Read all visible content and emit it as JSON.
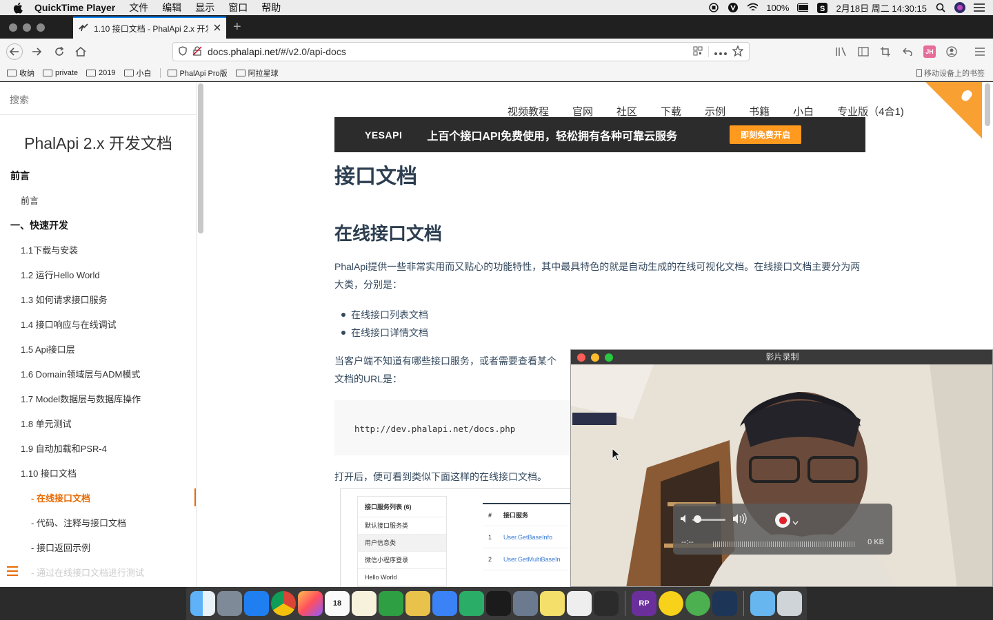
{
  "menubar": {
    "app_name": "QuickTime Player",
    "menus": [
      "文件",
      "编辑",
      "显示",
      "窗口",
      "帮助"
    ],
    "battery": "100%",
    "datetime": "2月18日 周二  14:30:15"
  },
  "browser": {
    "tab_title": "1.10 接口文档 - PhalApi 2.x 开发",
    "url_prefix": "docs.",
    "url_domain": "phalapi.net",
    "url_rest": "/#/v2.0/api-docs",
    "bookmarks": [
      "收纳",
      "private",
      "2019",
      "小白",
      "PhalApi Pro版",
      "阿拉星球"
    ],
    "mobile_bookmarks": "移动设备上的书签"
  },
  "sidebar": {
    "search_placeholder": "搜索",
    "title": "PhalApi 2.x 开发文档",
    "items": [
      {
        "label": "前言",
        "level": "h"
      },
      {
        "label": "前言",
        "level": "l1"
      },
      {
        "label": "一、快速开发",
        "level": "h"
      },
      {
        "label": "1.1下载与安装",
        "level": "l1"
      },
      {
        "label": "1.2 运行Hello World",
        "level": "l1"
      },
      {
        "label": "1.3 如何请求接口服务",
        "level": "l1"
      },
      {
        "label": "1.4 接口响应与在线调试",
        "level": "l1"
      },
      {
        "label": "1.5 Api接口层",
        "level": "l1"
      },
      {
        "label": "1.6 Domain领域层与ADM模式",
        "level": "l1"
      },
      {
        "label": "1.7 Model数据层与数据库操作",
        "level": "l1"
      },
      {
        "label": "1.8 单元测试",
        "level": "l1"
      },
      {
        "label": "1.9 自动加载和PSR-4",
        "level": "l1"
      },
      {
        "label": "1.10 接口文档",
        "level": "l1"
      },
      {
        "label": "- 在线接口文档",
        "level": "l2",
        "active": true
      },
      {
        "label": "- 代码、注释与接口文档",
        "level": "l2"
      },
      {
        "label": "- 接口返回示例",
        "level": "l2"
      },
      {
        "label": "- 通过在线接口文档进行测试",
        "level": "l2",
        "faded": true
      }
    ]
  },
  "content": {
    "topnav": [
      "视频教程",
      "官网",
      "社区",
      "下载",
      "示例",
      "书籍",
      "小白",
      "专业版（4合1)"
    ],
    "banner": {
      "logo": "YESAPI",
      "slogan": "上百个接口API免费使用，轻松拥有各种可靠云服务",
      "cta": "即刻免费开启"
    },
    "h1": "接口文档",
    "h2": "在线接口文档",
    "para1": "PhalApi提供一些非常实用而又贴心的功能特性，其中最具特色的就是自动生成的在线可视化文档。在线接口文档主要分为两大类，分别是：",
    "bullets": [
      "在线接口列表文档",
      "在线接口详情文档"
    ],
    "para2": "当客户端不知道有哪些接口服务，或者需要查看某个",
    "para2b": "文档的URL是：",
    "code": "http://dev.phalapi.net/docs.php",
    "para3": "打开后，便可看到类似下面这样的在线接口文档。",
    "screenshot": {
      "list_header": "接口服务列表 (6)",
      "list_items": [
        "默认接口服务类",
        "用户信息类",
        "微信小程序登录",
        "Hello World"
      ],
      "table_headers": [
        "#",
        "接口服务"
      ],
      "table_rows": [
        [
          "1",
          "User.GetBaseInfo"
        ],
        [
          "2",
          "User.GetMultiBaseIn"
        ]
      ]
    }
  },
  "quicktime": {
    "title": "影片录制",
    "time": "--:--",
    "size": "0 KB"
  },
  "dock": {
    "icons": [
      "finder-icon",
      "launchpad-icon",
      "safari-icon",
      "chrome-icon",
      "firefox-icon",
      "calendar-icon",
      "notes-icon",
      "numbers-icon",
      "clipboard-icon",
      "keynote-icon",
      "wechat-icon",
      "terminal-icon",
      "preview-icon",
      "stickies-icon",
      "textedit-icon",
      "activity-icon",
      "axure-icon",
      "music-icon",
      "green-app-icon",
      "quicktime-icon",
      "downloads-icon",
      "trash-icon"
    ],
    "calendar_day": "18",
    "axure_label": "RP"
  }
}
